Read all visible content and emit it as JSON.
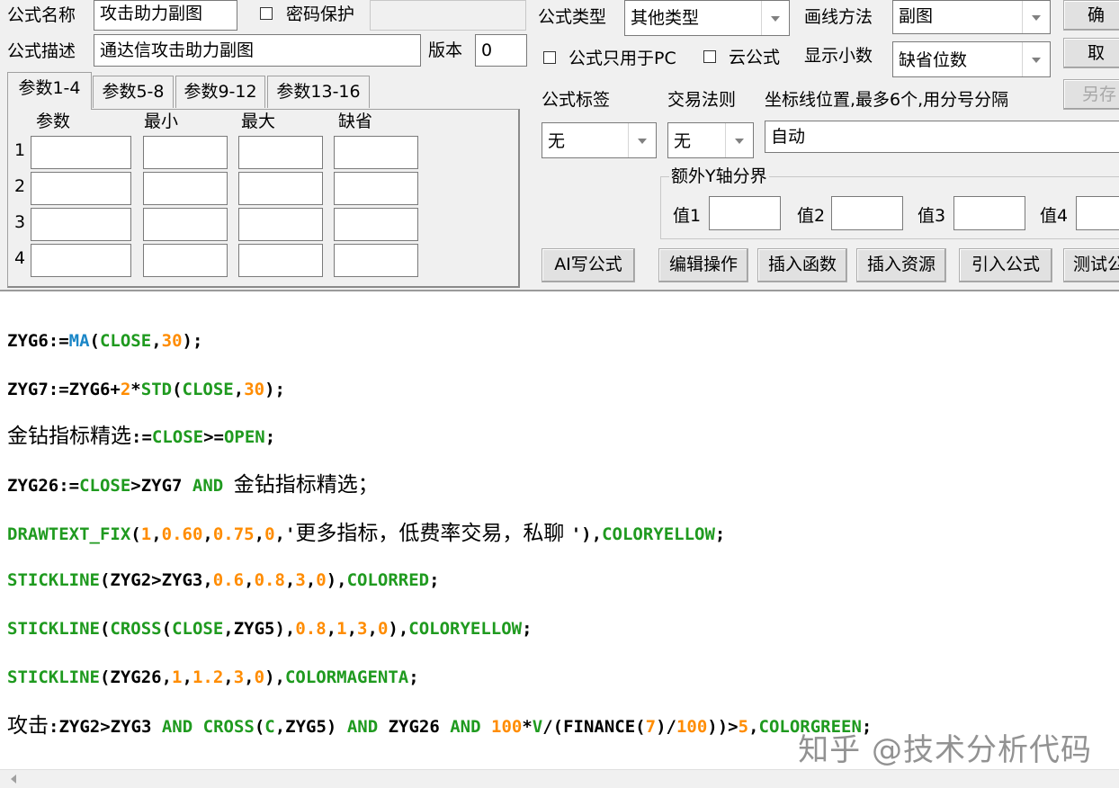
{
  "header": {
    "formula_name_label": "公式名称",
    "formula_name_value": "攻击助力副图",
    "password_checkbox_label": "密码保护",
    "formula_desc_label": "公式描述",
    "formula_desc_value": "通达信攻击助力副图",
    "version_label": "版本",
    "version_value": "0"
  },
  "params": {
    "tabs": [
      {
        "label": "参数1-4"
      },
      {
        "label": "参数5-8"
      },
      {
        "label": "参数9-12"
      },
      {
        "label": "参数13-16"
      }
    ],
    "columns": [
      "参数",
      "最小",
      "最大",
      "缺省"
    ],
    "rows": [
      "1",
      "2",
      "3",
      "4"
    ]
  },
  "settings": {
    "formula_type_label": "公式类型",
    "formula_type_value": "其他类型",
    "draw_method_label": "画线方法",
    "draw_method_value": "副图",
    "pc_only_label": "公式只用于PC",
    "cloud_label": "云公式",
    "decimals_label": "显示小数",
    "decimals_value": "缺省位数",
    "tag_label": "公式标签",
    "tag_value": "无",
    "trade_rule_label": "交易法则",
    "trade_rule_value": "无",
    "axis_label": "坐标线位置,最多6个,用分号分隔",
    "axis_value": "自动",
    "extra_y_label": "额外Y轴分界",
    "values": [
      "值1",
      "值2",
      "值3",
      "值4"
    ]
  },
  "buttons": {
    "confirm": "确",
    "cancel": "取",
    "save_as": "另存",
    "ai": "AI写公式",
    "edit": "编辑操作",
    "insert_func": "插入函数",
    "insert_res": "插入资源",
    "import": "引入公式",
    "test": "测试公"
  },
  "code": {
    "l1": {
      "a": "ZYG6:=",
      "b": "MA",
      "c": "(",
      "d": "CLOSE",
      "e": ",",
      "f": "30",
      "g": ");"
    },
    "l2": {
      "a": "ZYG7:=ZYG6+",
      "b": "2",
      "c": "*",
      "d": "STD",
      "e": "(",
      "f": "CLOSE",
      "g": ",",
      "h": "30",
      "i": ");"
    },
    "l3": {
      "a": "金钻指标精选",
      "b": ":=",
      "c": "CLOSE",
      "d": ">=",
      "e": "OPEN",
      "f": ";"
    },
    "l4": {
      "a": "ZYG26:=",
      "b": "CLOSE",
      "c": ">ZYG7 ",
      "d": "AND",
      "e": " ",
      "f": "金钻指标精选",
      "g": "；"
    },
    "l5": {
      "a": "DRAWTEXT_FIX",
      "b": "(",
      "c": "1",
      "d": ",",
      "e": "0.60",
      "f": ",",
      "g": "0.75",
      "h": ",",
      "i": "0",
      "j": ",'",
      "k": "更多指标，低费率交易，私聊 ",
      "l": "'),",
      "m": "COLORYELLOW",
      "n": ";"
    },
    "l6": {
      "a": "STICKLINE",
      "b": "(ZYG2>ZYG3,",
      "c": "0.6",
      "d": ",",
      "e": "0.8",
      "f": ",",
      "g": "3",
      "h": ",",
      "i": "0",
      "j": "),",
      "k": "COLORRED",
      "l": ";"
    },
    "l7": {
      "a": "STICKLINE",
      "b": "(",
      "c": "CROSS",
      "d": "(",
      "e": "CLOSE",
      "f": ",ZYG5),",
      "g": "0.8",
      "h": ",",
      "i": "1",
      "j": ",",
      "k": "3",
      "l": ",",
      "m": "0",
      "n": "),",
      "o": "COLORYELLOW",
      "p": ";"
    },
    "l8": {
      "a": "STICKLINE",
      "b": "(ZYG26,",
      "c": "1",
      "d": ",",
      "e": "1.2",
      "f": ",",
      "g": "3",
      "h": ",",
      "i": "0",
      "j": "),",
      "k": "COLORMAGENTA",
      "l": ";"
    },
    "l9": {
      "a": "攻击",
      "b": ":ZYG2>ZYG3 ",
      "c": "AND",
      "d": " ",
      "e": "CROSS",
      "f": "(",
      "g": "C",
      "h": ",ZYG5) ",
      "i": "AND",
      "j": " ZYG26 ",
      "k": "AND",
      "l": " ",
      "m": "100",
      "n": "*",
      "o": "V",
      "p": "/(FINANCE(",
      "q": "7",
      "r": ")/",
      "s": "100",
      "t": "))>",
      "u": "5",
      "v": ",",
      "w": "COLORGREEN",
      "x": ";"
    }
  },
  "watermark": "知乎 @技术分析代码",
  "colors": {
    "function_blue": "#1a86c7",
    "keyword_green": "#1f9a1f",
    "number_orange": "#ff8c00",
    "background": "#f0f0f0"
  }
}
